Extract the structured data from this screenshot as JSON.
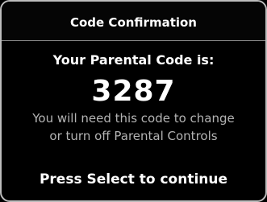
{
  "dialog": {
    "title": "Code Confirmation",
    "heading": "Your Parental Code is:",
    "code": "3287",
    "note_line1": "You will need this code to change",
    "note_line2": "or turn off Parental Controls",
    "action_hint": "Press Select to continue"
  },
  "colors": {
    "background": "#000000",
    "border": "#bdbdbd",
    "text": "#ffffff",
    "muted_text": "#b3b3b3"
  }
}
